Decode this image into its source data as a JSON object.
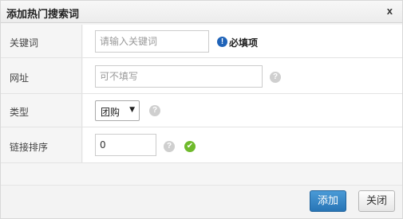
{
  "dialog": {
    "title": "添加热门搜索词",
    "close_label": "x"
  },
  "form": {
    "keyword": {
      "label": "关键词",
      "placeholder": "请输入关键词",
      "required_text": "必填项",
      "info_glyph": "!"
    },
    "url": {
      "label": "网址",
      "placeholder": "可不填写",
      "help_glyph": "?"
    },
    "type": {
      "label": "类型",
      "selected": "团购",
      "arrow": "▼",
      "help_glyph": "?"
    },
    "sort": {
      "label": "链接排序",
      "value": "0",
      "help_glyph": "?",
      "ok_glyph": "✔"
    }
  },
  "footer": {
    "add_label": "添加",
    "close_label": "关闭"
  },
  "colors": {
    "primary_button": "#2875b6",
    "ok_icon": "#6fba2c",
    "info_icon": "#1f63b8"
  }
}
